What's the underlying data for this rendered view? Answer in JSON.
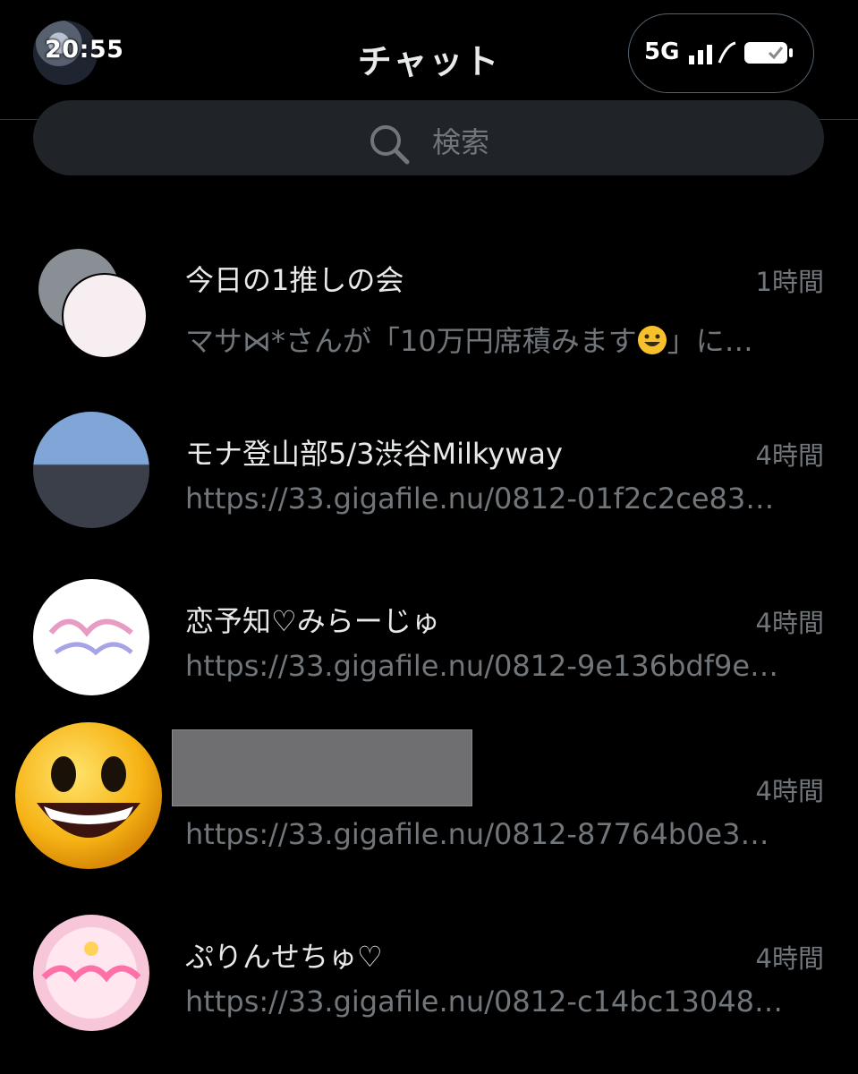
{
  "status_bar": {
    "time": "20:55",
    "network": "5G"
  },
  "header": {
    "title": "チャット"
  },
  "search": {
    "placeholder": "検索"
  },
  "chats": [
    {
      "name": "今日の1推しの会",
      "time": "1時間",
      "preview_before": "マサ⋈*さんが「10万円席積みます",
      "preview_after": "」に…",
      "avatar_icon": "group-avatar-icon"
    },
    {
      "name": "モナ登山部5/3渋谷Milkyway",
      "time": "4時間",
      "preview": "https://33.gigafile.nu/0812-01f2c2ce83…",
      "avatar_icon": "photo-avatar"
    },
    {
      "name": "恋予知♡みらーじゅ",
      "time": "4時間",
      "preview": "https://33.gigafile.nu/0812-9e136bdf9e…",
      "avatar_icon": "logo-avatar"
    },
    {
      "name": "",
      "time": "4時間",
      "preview": "https://33.gigafile.nu/0812-87764b0e3…",
      "avatar_icon": "smiley-emoji"
    },
    {
      "name": "ぷりんせちゅ♡",
      "time": "4時間",
      "preview": "https://33.gigafile.nu/0812-c14bc13048…",
      "avatar_icon": "logo-avatar"
    }
  ],
  "colors": {
    "background": "#000000",
    "text": "#e7e9ea",
    "secondary": "#71767b",
    "search_bg": "#202327"
  }
}
